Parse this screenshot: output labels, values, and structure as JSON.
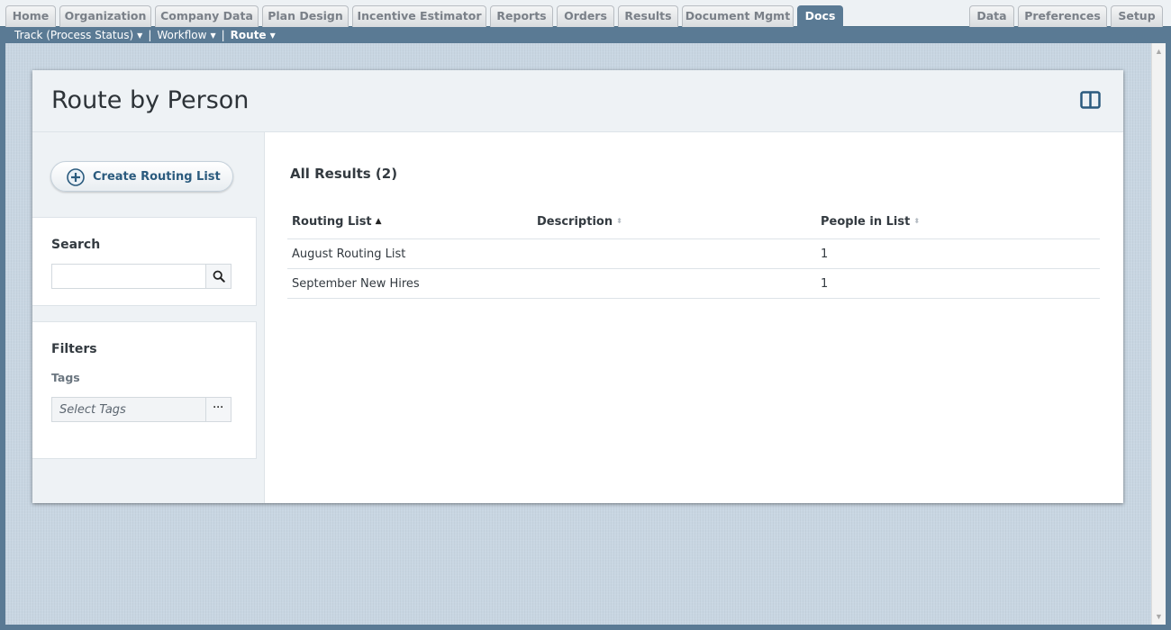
{
  "tabs": [
    {
      "label": "Home",
      "active": false
    },
    {
      "label": "Organization",
      "active": false
    },
    {
      "label": "Company Data",
      "active": false
    },
    {
      "label": "Plan Design",
      "active": false
    },
    {
      "label": "Incentive Estimator",
      "active": false
    },
    {
      "label": "Reports",
      "active": false
    },
    {
      "label": "Orders",
      "active": false
    },
    {
      "label": "Results",
      "active": false
    },
    {
      "label": "Document Mgmt",
      "active": false
    },
    {
      "label": "Docs",
      "active": true
    }
  ],
  "right_tabs": [
    {
      "label": "Data"
    },
    {
      "label": "Preferences"
    },
    {
      "label": "Setup"
    }
  ],
  "subnav": {
    "items": [
      {
        "label": "Track (Process Status)"
      },
      {
        "label": "Workflow"
      },
      {
        "label": "Route"
      }
    ],
    "separator": "|"
  },
  "page": {
    "title": "Route by Person"
  },
  "sidebar": {
    "create_button": "Create Routing List",
    "search_title": "Search",
    "search_value": "",
    "filters_title": "Filters",
    "tags_label": "Tags",
    "tags_placeholder": "Select Tags",
    "tags_button": "···"
  },
  "results": {
    "title": "All Results (2)",
    "columns": [
      "Routing List",
      "Description",
      "People in List"
    ],
    "sort_column": "Routing List",
    "sort_direction": "ascending",
    "rows": [
      {
        "routing_list": "August Routing List",
        "description": "",
        "people": "1"
      },
      {
        "routing_list": "September New Hires",
        "description": "",
        "people": "1"
      }
    ]
  },
  "colors": {
    "nav_blue": "#5a7a94",
    "accent": "#2b5b7e",
    "content_bg": "#c8d6e2"
  }
}
